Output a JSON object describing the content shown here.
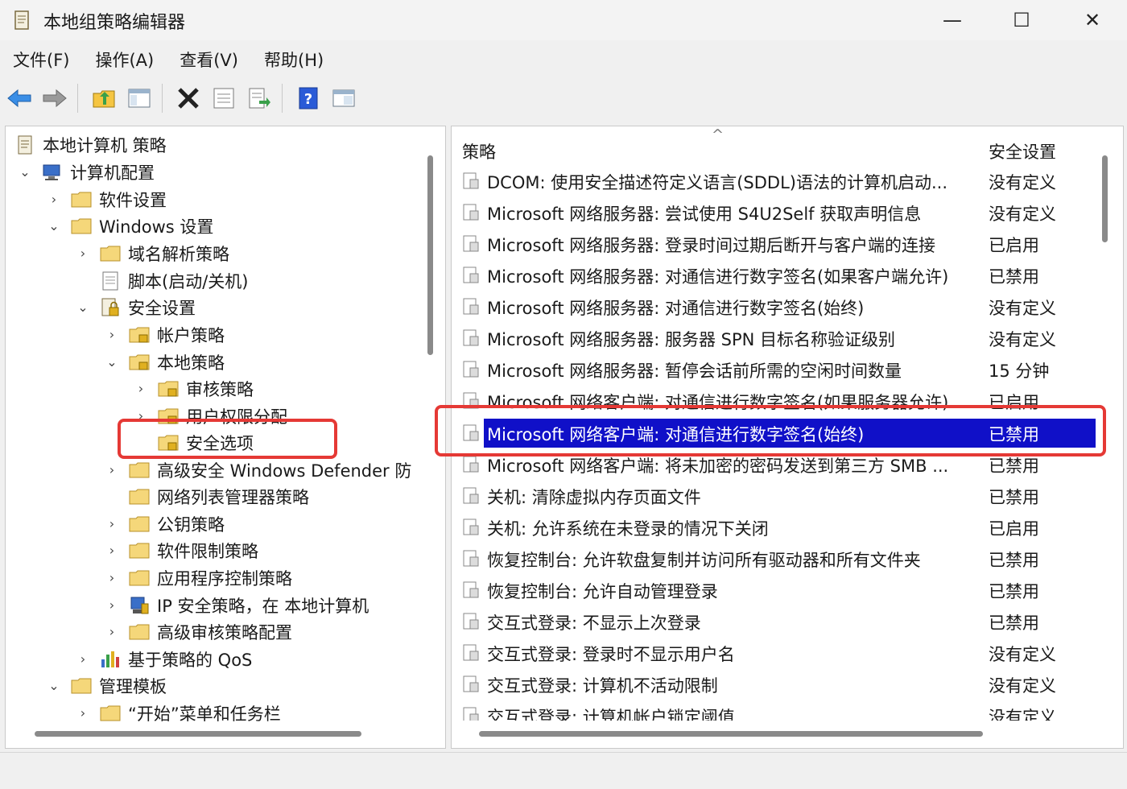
{
  "window": {
    "title": "本地组策略编辑器",
    "minimize_glyph": "—",
    "maximize_glyph": "☐",
    "close_glyph": "✕"
  },
  "menu": [
    "文件(F)",
    "操作(A)",
    "查看(V)",
    "帮助(H)"
  ],
  "toolbar": {
    "icons": [
      "back-arrow-icon",
      "forward-arrow-icon",
      "up-folder-icon",
      "show-hide-tree-icon",
      "delete-icon",
      "properties-icon",
      "export-list-icon",
      "help-icon",
      "console-view-icon"
    ]
  },
  "tree": [
    {
      "label": "本地计算机 策略",
      "expander": ""
    },
    {
      "label": "计算机配置",
      "expander": "⌄"
    },
    {
      "label": "软件设置",
      "expander": "›"
    },
    {
      "label": "Windows 设置",
      "expander": "⌄"
    },
    {
      "label": "域名解析策略",
      "expander": "›"
    },
    {
      "label": "脚本(启动/关机)",
      "expander": ""
    },
    {
      "label": "安全设置",
      "expander": "⌄"
    },
    {
      "label": "帐户策略",
      "expander": "›"
    },
    {
      "label": "本地策略",
      "expander": "⌄"
    },
    {
      "label": "审核策略",
      "expander": "›"
    },
    {
      "label": "用户权限分配",
      "expander": "›"
    },
    {
      "label": "安全选项",
      "expander": ""
    },
    {
      "label": "高级安全 Windows Defender 防",
      "expander": "›"
    },
    {
      "label": "网络列表管理器策略",
      "expander": ""
    },
    {
      "label": "公钥策略",
      "expander": "›"
    },
    {
      "label": "软件限制策略",
      "expander": "›"
    },
    {
      "label": "应用程序控制策略",
      "expander": "›"
    },
    {
      "label": "IP 安全策略，在 本地计算机",
      "expander": "›"
    },
    {
      "label": "高级审核策略配置",
      "expander": "›"
    },
    {
      "label": "基于策略的 QoS",
      "expander": "›"
    },
    {
      "label": "管理模板",
      "expander": "⌄"
    },
    {
      "label": "“开始”菜单和任务栏",
      "expander": "›"
    }
  ],
  "list": {
    "header_policy": "策略",
    "header_setting": "安全设置",
    "sort_glyph": "^",
    "rows": [
      {
        "name": "DCOM: 使用安全描述符定义语言(SDDL)语法的计算机启动...",
        "value": "没有定义"
      },
      {
        "name": "Microsoft 网络服务器: 尝试使用 S4U2Self 获取声明信息",
        "value": "没有定义"
      },
      {
        "name": "Microsoft 网络服务器: 登录时间过期后断开与客户端的连接",
        "value": "已启用"
      },
      {
        "name": "Microsoft 网络服务器: 对通信进行数字签名(如果客户端允许)",
        "value": "已禁用"
      },
      {
        "name": "Microsoft 网络服务器: 对通信进行数字签名(始终)",
        "value": "没有定义"
      },
      {
        "name": "Microsoft 网络服务器: 服务器 SPN 目标名称验证级别",
        "value": "没有定义"
      },
      {
        "name": "Microsoft 网络服务器: 暂停会话前所需的空闲时间数量",
        "value": "15 分钟"
      },
      {
        "name": "Microsoft 网络客户端: 对通信进行数字签名(如果服务器允许)",
        "value": "已启用"
      },
      {
        "name": "Microsoft 网络客户端: 对通信进行数字签名(始终)",
        "value": "已禁用"
      },
      {
        "name": "Microsoft 网络客户端: 将未加密的密码发送到第三方 SMB ...",
        "value": "已禁用"
      },
      {
        "name": "关机: 清除虚拟内存页面文件",
        "value": "已禁用"
      },
      {
        "name": "关机: 允许系统在未登录的情况下关闭",
        "value": "已启用"
      },
      {
        "name": "恢复控制台: 允许软盘复制并访问所有驱动器和所有文件夹",
        "value": "已禁用"
      },
      {
        "name": "恢复控制台: 允许自动管理登录",
        "value": "已禁用"
      },
      {
        "name": "交互式登录: 不显示上次登录",
        "value": "已禁用"
      },
      {
        "name": "交互式登录: 登录时不显示用户名",
        "value": "没有定义"
      },
      {
        "name": "交互式登录: 计算机不活动限制",
        "value": "没有定义"
      },
      {
        "name": "交互式登录: 计算机帐户锁定阈值",
        "value": "没有定义"
      }
    ]
  },
  "colors": {
    "selection": "#1010c8",
    "annotation": "#e53935",
    "folder": "#f5d77a"
  }
}
